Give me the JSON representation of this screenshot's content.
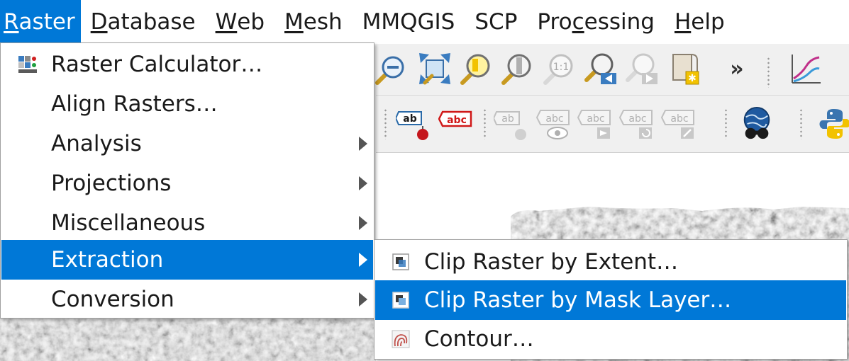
{
  "menubar": {
    "items": [
      {
        "first": "R",
        "rest": "aster",
        "active": true
      },
      {
        "first": "D",
        "rest": "atabase"
      },
      {
        "first": "W",
        "rest": "eb"
      },
      {
        "first": "M",
        "rest": "esh"
      },
      {
        "first": "",
        "rest": "MMQGIS"
      },
      {
        "first": "",
        "rest": "SCP"
      },
      {
        "pre": "Pro",
        "first": "c",
        "rest": "essing"
      },
      {
        "first": "H",
        "rest": "elp"
      }
    ]
  },
  "raster_menu": {
    "items": [
      {
        "label": "Raster Calculator…",
        "icon": "raster-calculator-icon",
        "submenu": false
      },
      {
        "label": "Align Rasters…",
        "submenu": false
      },
      {
        "label": "Analysis",
        "submenu": true
      },
      {
        "label": "Projections",
        "submenu": true
      },
      {
        "label": "Miscellaneous",
        "submenu": true
      },
      {
        "label": "Extraction",
        "submenu": true,
        "highlighted": true
      },
      {
        "label": "Conversion",
        "submenu": true
      }
    ]
  },
  "extraction_submenu": {
    "items": [
      {
        "label": "Clip Raster by Extent…",
        "icon": "clip-extent-icon"
      },
      {
        "label": "Clip Raster by Mask Layer…",
        "icon": "clip-mask-icon",
        "highlighted": true
      },
      {
        "label": "Contour…",
        "icon": "contour-icon"
      }
    ]
  },
  "toolbar1": {
    "icons": [
      "zoom-out-icon",
      "zoom-full-icon",
      "zoom-to-selection-icon",
      "zoom-to-layer-icon",
      "zoom-native-icon",
      "zoom-last-icon",
      "zoom-next-icon",
      "new-map-view-icon",
      "more-tools-icon",
      "profile-tool-icon"
    ],
    "zoom_native_text": "1:1",
    "more_text": "»"
  },
  "toolbar2": {
    "icons": [
      "label-pin-icon",
      "label-highlight-icon",
      "label-pin-disabled-icon",
      "label-show-hide-icon",
      "label-move-icon",
      "label-rotate-icon",
      "label-change-icon",
      "globe-binoculars-icon",
      "python-icon"
    ],
    "label_text": "abc",
    "label_short": "ab"
  },
  "colors": {
    "accent": "#0078d7",
    "menu_bg": "#ffffff",
    "toolbar_bg": "#f0f0f0"
  }
}
